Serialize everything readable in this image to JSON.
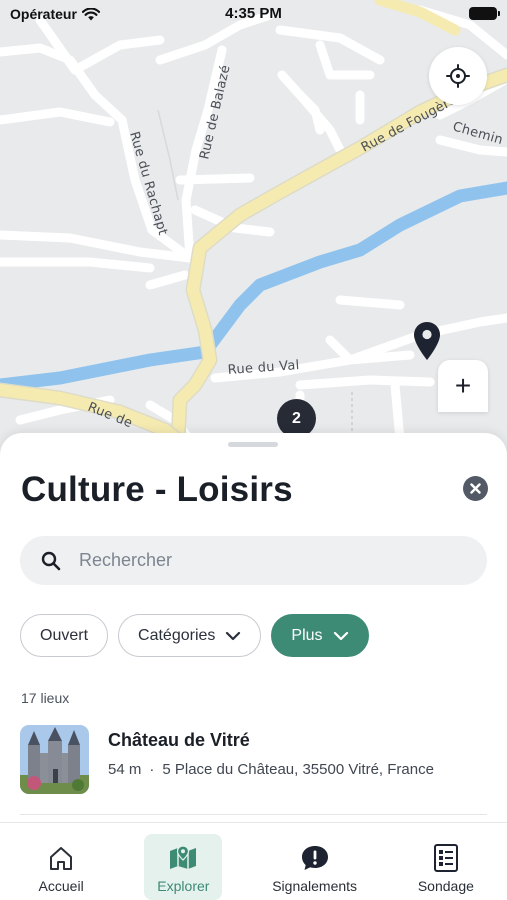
{
  "status_bar": {
    "carrier": "Opérateur",
    "time": "4:35 PM"
  },
  "map": {
    "streets": [
      "Rue de Fougères",
      "Chemin",
      "Rue de Balazé",
      "Rue du Rachapt",
      "Rue du Val",
      "Rue de"
    ],
    "cluster_count": "2",
    "zoom_in": "+",
    "colors": {
      "water": "#8fc3ee",
      "main_road": "#f5ebb1",
      "road": "#ffffff",
      "land": "#e8eaec"
    }
  },
  "sheet": {
    "title": "Culture - Loisirs",
    "search_placeholder": "Rechercher",
    "filters": [
      {
        "label": "Ouvert",
        "has_chevron": false,
        "active": false
      },
      {
        "label": "Catégories",
        "has_chevron": true,
        "active": false
      },
      {
        "label": "Plus",
        "has_chevron": true,
        "active": true
      }
    ],
    "result_count": "17 lieux",
    "places": [
      {
        "name": "Château de Vitré",
        "distance": "54 m",
        "separator": "·",
        "address": "5 Place du Château, 35500 Vitré, France"
      }
    ]
  },
  "tabbar": {
    "items": [
      {
        "label": "Accueil",
        "icon": "home-icon",
        "selected": false
      },
      {
        "label": "Explorer",
        "icon": "map-icon",
        "selected": true
      },
      {
        "label": "Signalements",
        "icon": "alert-bubble-icon",
        "selected": false
      },
      {
        "label": "Sondage",
        "icon": "poll-icon",
        "selected": false
      }
    ]
  },
  "colors": {
    "accent": "#3d8a75",
    "accent_light": "#e5f1ed",
    "text": "#1b1f27",
    "cluster": "#262b36"
  }
}
